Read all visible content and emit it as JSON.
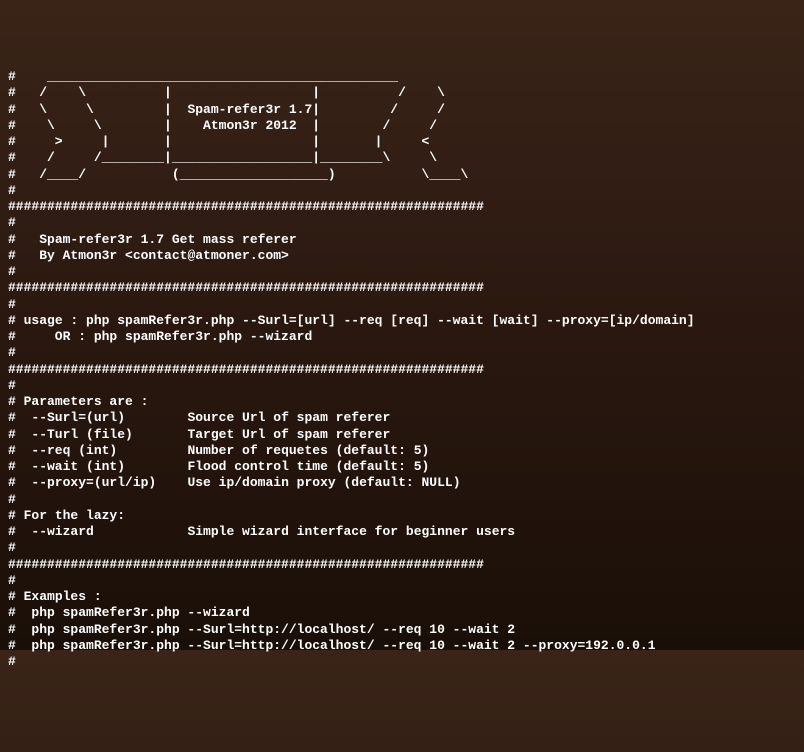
{
  "banner": {
    "ascii_art": "#    _____________________________________________\n#   /    \\          |                  |          /    \\\n#   \\     \\         |  Spam-refer3r 1.7|         /     /\n#    \\     \\        |    Atmon3r 2012  |        /     /\n#     >     |       |                  |       |     <\n#    /     /________|__________________|________\\     \\\n#   /____/           (___________________)           \\____\\",
    "title": "Spam-refer3r 1.7",
    "author": "Atmon3r 2012"
  },
  "separator": "#############################################################",
  "header": {
    "line1": "Spam-refer3r 1.7 Get mass referer",
    "line2": "By Atmon3r <contact@atmoner.com>"
  },
  "usage": {
    "line1": "usage : php spamRefer3r.php --Surl=[url] --req [req] --wait [wait] --proxy=[ip/domain]",
    "line2": "   OR : php spamRefer3r.php --wizard"
  },
  "parameters": {
    "title": "Parameters are :",
    "items": [
      {
        "flag": "--Surl=(url)",
        "desc": "Source Url of spam referer"
      },
      {
        "flag": "--Turl (file)",
        "desc": "Target Url of spam referer"
      },
      {
        "flag": "--req (int)",
        "desc": "Number of requetes (default: 5)"
      },
      {
        "flag": "--wait (int)",
        "desc": "Flood control time (default: 5)"
      },
      {
        "flag": "--proxy=(url/ip)",
        "desc": "Use ip/domain proxy (default: NULL)"
      }
    ],
    "lazy_title": "For the lazy:",
    "lazy_item": {
      "flag": "--wizard",
      "desc": "Simple wizard interface for beginner users"
    }
  },
  "examples": {
    "title": "Examples :",
    "items": [
      "php spamRefer3r.php --wizard",
      "php spamRefer3r.php --Surl=http://localhost/ --req 10 --wait 2",
      "php spamRefer3r.php --Surl=http://localhost/ --req 10 --wait 2 --proxy=192.0.0.1"
    ]
  }
}
